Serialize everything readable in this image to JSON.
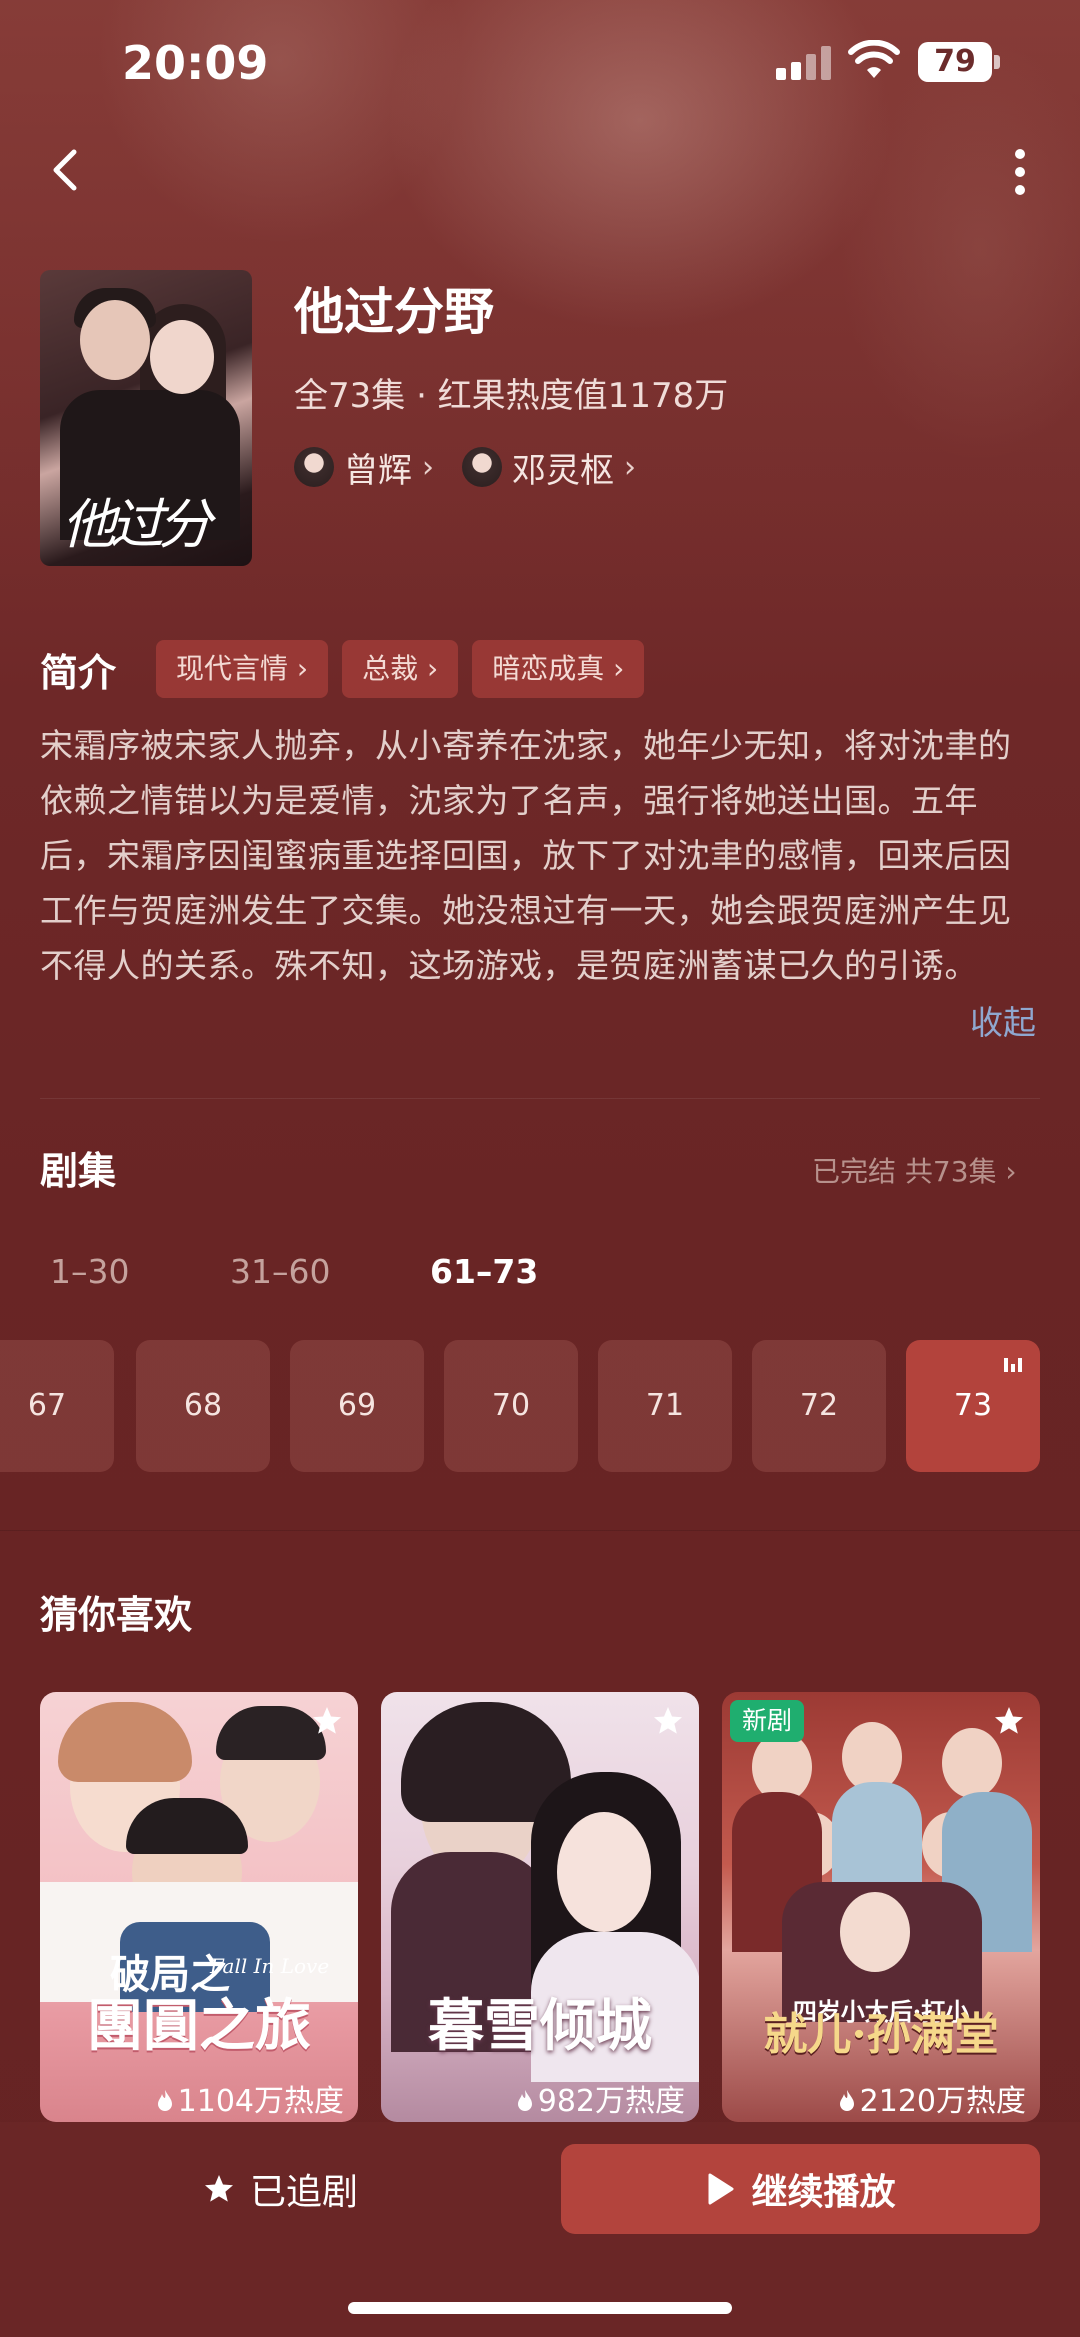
{
  "status_bar": {
    "time": "20:09",
    "battery": "79"
  },
  "show": {
    "title": "他过分野",
    "meta": "全73集 · 红果热度值1178万",
    "poster_text": "他过分野",
    "cast": [
      {
        "name": "曾辉"
      },
      {
        "name": "邓灵枢"
      }
    ]
  },
  "intro": {
    "title": "简介",
    "tags": [
      "现代言情 ›",
      "总裁 ›",
      "暗恋成真 ›"
    ],
    "text": "宋霜序被宋家人抛弃，从小寄养在沈家，她年少无知，将对沈聿的依赖之情错以为是爱情，沈家为了名声，强行将她送出国。五年后，宋霜序因闺蜜病重选择回国，放下了对沈聿的感情，回来后因工作与贺庭洲发生了交集。她没想过有一天，她会跟贺庭洲产生见不得人的关系。殊不知，这场游戏，是贺庭洲蓄谋已久的引诱。",
    "collapse": "收起"
  },
  "episodes": {
    "title": "剧集",
    "status": "已完结 共73集 ›",
    "ranges": [
      "1–30",
      "31–60",
      "61–73"
    ],
    "active_range": "61–73",
    "items": [
      "67",
      "68",
      "69",
      "70",
      "71",
      "72",
      "73"
    ],
    "current": "73"
  },
  "recommend": {
    "title": "猜你喜欢",
    "items": [
      {
        "cover_title": "團圓之旅",
        "cover_sub": "破局之",
        "cover_en": "Fall In Love",
        "heat": "1104万热度",
        "badge": ""
      },
      {
        "cover_title": "暮雪倾城",
        "cover_sub": "",
        "cover_en": "",
        "heat": "982万热度",
        "badge": ""
      },
      {
        "cover_title": "就儿·孙满堂",
        "cover_sub": "四岁小太后·打小",
        "cover_en": "",
        "heat": "2120万热度",
        "badge": "新剧"
      }
    ]
  },
  "bottom": {
    "follow_label": "已追剧",
    "play_label": "继续播放"
  },
  "colors": {
    "background": "#6b2424",
    "accent": "#b3443d",
    "tag_bg": "#a53e3a",
    "link": "#8fa7cf",
    "new_badge": "#1fae6f"
  },
  "icons": [
    "back-icon",
    "more-icon",
    "signal-icon",
    "wifi-icon",
    "battery-icon",
    "star-icon",
    "play-icon",
    "flame-icon",
    "chevron-right-icon",
    "playing-icon"
  ]
}
